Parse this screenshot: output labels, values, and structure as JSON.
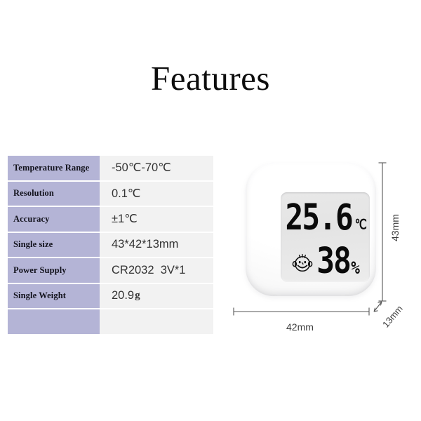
{
  "page": {
    "title": "Features",
    "background_color": "#ffffff"
  },
  "spec_table": {
    "label_column_color": "#b4b4d6",
    "value_column_color": "#f2f2f2",
    "rows": [
      {
        "label": "Temperature Range",
        "value": "-50℃-70℃",
        "unit_sub": ""
      },
      {
        "label": "Resolution",
        "value": "0.1℃",
        "unit_sub": ""
      },
      {
        "label": "Accuracy",
        "value": "±1℃",
        "unit_sub": ""
      },
      {
        "label": "Single size",
        "value": "43*42*13mm",
        "unit_sub": ""
      },
      {
        "label": "Power Supply",
        "value": "CR2032  3V*1",
        "unit_sub": ""
      },
      {
        "label": "Single Weight",
        "value": "20.9",
        "unit_sub": "g"
      },
      {
        "label": "",
        "value": "",
        "unit_sub": ""
      }
    ]
  },
  "device": {
    "name": "indoor-thermometer-hygrometer",
    "body_color": "#ffffff",
    "lcd_color": "#e8e8e8",
    "display": {
      "temperature": "25.6",
      "temperature_unit": "℃",
      "humidity": "38",
      "humidity_unit": "%",
      "comfort_icon": "smiley-face-icon"
    },
    "dimensions": {
      "width": "42mm",
      "height": "43mm",
      "depth": "13mm"
    }
  }
}
